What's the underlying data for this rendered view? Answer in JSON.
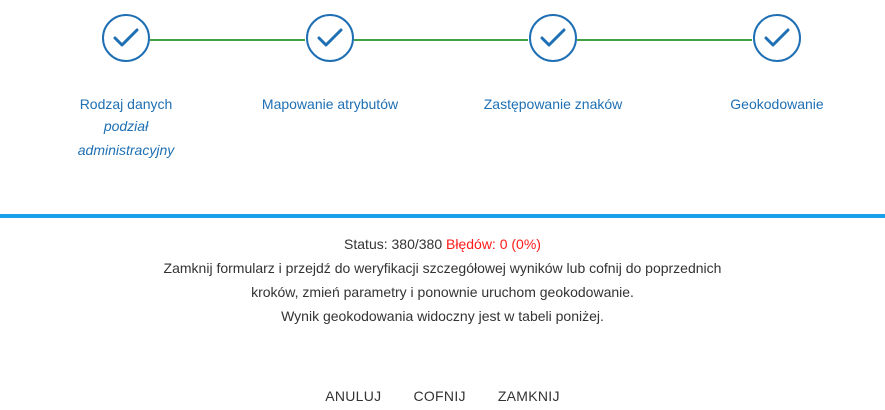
{
  "colors": {
    "step_accent": "#1e6fb3",
    "connector": "#43a047",
    "divider": "#1aa0e8",
    "error_text": "#ff1a1a",
    "body_text": "#333333"
  },
  "steps": [
    {
      "label": "Rodzaj danych",
      "sublabel": "podział administracyjny",
      "icon": "checkmark-icon",
      "completed": true
    },
    {
      "label": "Mapowanie atrybutów",
      "icon": "checkmark-icon",
      "completed": true
    },
    {
      "label": "Zastępowanie znaków",
      "icon": "checkmark-icon",
      "completed": true
    },
    {
      "label": "Geokodowanie",
      "icon": "checkmark-icon",
      "completed": true
    }
  ],
  "status": {
    "prefix": "Status: 380/380",
    "errors": "Błędów: 0 (0%)",
    "message_line1": "Zamknij formularz i przejdź do weryfikacji szczegółowej wyników lub cofnij do poprzednich",
    "message_line2": "kroków, zmień parametry i ponownie uruchom geokodowanie.",
    "message_line3": "Wynik geokodowania widoczny jest w tabeli poniżej."
  },
  "actions": {
    "cancel_label": "ANULUJ",
    "back_label": "COFNIJ",
    "close_label": "ZAMKNIJ"
  }
}
